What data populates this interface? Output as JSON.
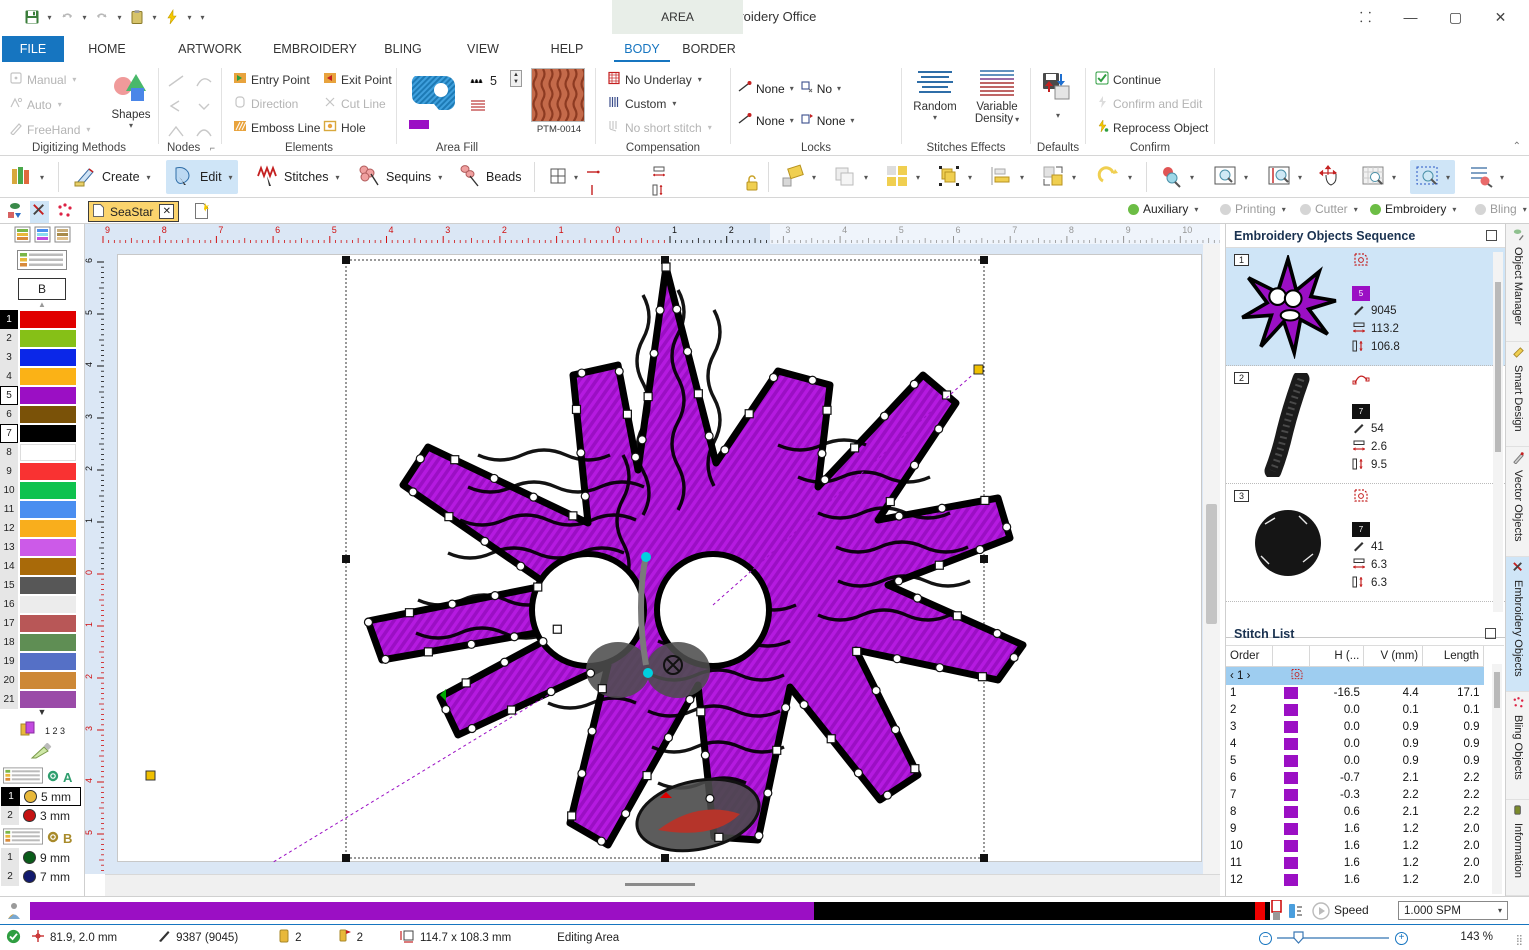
{
  "window": {
    "title": "Embroidery Office",
    "context_tab_chip": "AREA",
    "buttons": {
      "restore_small": "⸬",
      "minimize": "—",
      "maximize": "▢",
      "close": "✕"
    }
  },
  "quick_access": {
    "save": "save-icon",
    "undo": "undo-icon",
    "redo": "redo-icon",
    "paste": "clipboard-icon",
    "lightning": "lightning-icon"
  },
  "ribbon": {
    "tabs": [
      {
        "label": "FILE",
        "active": false,
        "file": true
      },
      {
        "label": "HOME",
        "active": false
      },
      {
        "label": "ARTWORK",
        "active": false
      },
      {
        "label": "EMBROIDERY",
        "active": false
      },
      {
        "label": "BLING",
        "active": false
      },
      {
        "label": "VIEW",
        "active": false
      },
      {
        "label": "HELP",
        "active": false
      },
      {
        "label": "BODY",
        "active": true
      },
      {
        "label": "BORDER",
        "active": false
      }
    ],
    "groups": {
      "digitizing": {
        "label": "Digitizing Methods",
        "items": [
          {
            "label": "Manual",
            "enabled": false
          },
          {
            "label": "Auto",
            "enabled": false
          },
          {
            "label": "FreeHand",
            "enabled": false
          }
        ],
        "shapes_label": "Shapes"
      },
      "nodes": {
        "label": "Nodes"
      },
      "elements": {
        "label": "Elements",
        "items": [
          {
            "label": "Entry Point",
            "enabled": true
          },
          {
            "label": "Exit Point",
            "enabled": true
          },
          {
            "label": "Direction",
            "enabled": false
          },
          {
            "label": "Cut Line",
            "enabled": false
          },
          {
            "label": "Emboss Line",
            "enabled": true
          },
          {
            "label": "Hole",
            "enabled": true
          }
        ]
      },
      "area_fill": {
        "label": "Area Fill",
        "stitch_count": "5",
        "pattern_code": "PTM-0014"
      },
      "compensation": {
        "label": "Compensation",
        "items": [
          {
            "label": "No Underlay",
            "enabled": true
          },
          {
            "label": "Custom",
            "enabled": true
          },
          {
            "label": "No short stitch",
            "enabled": false
          }
        ]
      },
      "locks": {
        "label": "Locks",
        "start_lock": "None",
        "start_trim": "No",
        "end_lock": "None",
        "end_trim": "None"
      },
      "stitches_effects": {
        "label": "Stitches Effects",
        "random": "Random",
        "variable_density_line1": "Variable",
        "variable_density_line2": "Density"
      },
      "defaults": {
        "label": "Defaults"
      },
      "confirm": {
        "label": "Confirm",
        "items": [
          {
            "label": "Continue",
            "enabled": true
          },
          {
            "label": "Confirm and Edit",
            "enabled": false
          },
          {
            "label": "Reprocess Object",
            "enabled": true
          }
        ]
      }
    }
  },
  "toolbar2": {
    "items": [
      {
        "label": "Create",
        "selected": false,
        "name": "create"
      },
      {
        "label": "Edit",
        "selected": true,
        "name": "edit"
      },
      {
        "label": "Stitches",
        "selected": false,
        "name": "stitches"
      },
      {
        "label": "Sequins",
        "selected": false,
        "name": "sequins"
      },
      {
        "label": "Beads",
        "selected": false,
        "name": "beads"
      }
    ],
    "pos_x": "-55.0 mm",
    "pos_y": "59.0 mm",
    "size_w": "113.2 mm",
    "size_h": "106.8 mm"
  },
  "document": {
    "tab_label": "SeaStar",
    "close_glyph": "✕"
  },
  "device_status": [
    {
      "label": "Auxiliary",
      "color": "#6cbd45"
    },
    {
      "label": "Printing",
      "color": "#cfcfcf"
    },
    {
      "label": "Cutter",
      "color": "#cfcfcf"
    },
    {
      "label": "Embroidery",
      "color": "#6cbd45"
    },
    {
      "label": "Bling",
      "color": "#cfcfcf"
    }
  ],
  "rulers": {
    "unit": "cm",
    "h_labels": [
      "9",
      "8",
      "7",
      "6",
      "5",
      "4",
      "3",
      "2",
      "1",
      "0",
      "1",
      "2",
      "3",
      "4",
      "5",
      "6",
      "7",
      "8",
      "9",
      "10"
    ],
    "v_labels": [
      "6",
      "5",
      "4",
      "3",
      "2",
      "1",
      "0",
      "1",
      "2",
      "3",
      "4",
      "5"
    ]
  },
  "palette": {
    "b_button": "B",
    "swatches": [
      {
        "n": "1",
        "color": "#e00000",
        "state": "sel"
      },
      {
        "n": "2",
        "color": "#86c017",
        "state": ""
      },
      {
        "n": "3",
        "color": "#0b27e8",
        "state": ""
      },
      {
        "n": "4",
        "color": "#fbb216",
        "state": ""
      },
      {
        "n": "5",
        "color": "#9b0fc4",
        "state": "boxed"
      },
      {
        "n": "6",
        "color": "#7a5208",
        "state": ""
      },
      {
        "n": "7",
        "color": "#000000",
        "state": "boxed"
      },
      {
        "n": "8",
        "color": "#ffffff",
        "state": ""
      },
      {
        "n": "9",
        "color": "#f93232",
        "state": ""
      },
      {
        "n": "10",
        "color": "#0ec24e",
        "state": ""
      },
      {
        "n": "11",
        "color": "#4a8ef0",
        "state": ""
      },
      {
        "n": "12",
        "color": "#f9ae1c",
        "state": ""
      },
      {
        "n": "13",
        "color": "#cc5ae8",
        "state": ""
      },
      {
        "n": "14",
        "color": "#a96a09",
        "state": ""
      },
      {
        "n": "15",
        "color": "#575757",
        "state": ""
      },
      {
        "n": "16",
        "color": "#ececec",
        "state": ""
      },
      {
        "n": "17",
        "color": "#b85757",
        "state": ""
      },
      {
        "n": "18",
        "color": "#5f8e54",
        "state": ""
      },
      {
        "n": "19",
        "color": "#5570c6",
        "state": ""
      },
      {
        "n": "20",
        "color": "#cd8836",
        "state": ""
      },
      {
        "n": "21",
        "color": "#9a4ba8",
        "state": ""
      }
    ],
    "order_badge": "1 2 3",
    "group_a": {
      "label": "A",
      "needles": [
        {
          "n": "1",
          "size": "5 mm",
          "color": "#e8b83a",
          "selected": true
        },
        {
          "n": "2",
          "size": "3 mm",
          "color": "#c41212",
          "selected": false
        }
      ]
    },
    "group_b": {
      "label": "B",
      "needles": [
        {
          "n": "1",
          "size": "9 mm",
          "color": "#0a5c1a",
          "selected": false
        },
        {
          "n": "2",
          "size": "7 mm",
          "color": "#121a6e",
          "selected": false
        }
      ]
    }
  },
  "objects_panel": {
    "title": "Embroidery Objects Sequence",
    "rows": [
      {
        "index": "1",
        "selected": true,
        "type_icon": "area-object-icon",
        "color": "#9b0fc4",
        "color_num": "5",
        "stitches": "9045",
        "width": "113.2",
        "height": "106.8",
        "thumb": "starfish"
      },
      {
        "index": "2",
        "selected": false,
        "type_icon": "line-object-icon",
        "color": "#111111",
        "color_num": "7",
        "stitches": "54",
        "width": "2.6",
        "height": "9.5",
        "thumb": "curve"
      },
      {
        "index": "3",
        "selected": false,
        "type_icon": "area-object-icon",
        "color": "#111111",
        "color_num": "7",
        "stitches": "41",
        "width": "6.3",
        "height": "6.3",
        "thumb": "blob"
      }
    ]
  },
  "stitch_list": {
    "title": "Stitch List",
    "columns": [
      "Order",
      "",
      "H (...",
      "V (mm)",
      "Length"
    ],
    "group_row": {
      "label": "‹ 1 ›"
    },
    "rows": [
      {
        "order": "1",
        "color": "#9b0fc4",
        "h": "-16.5",
        "v": "4.4",
        "len": "17.1"
      },
      {
        "order": "2",
        "color": "#9b0fc4",
        "h": "0.0",
        "v": "0.1",
        "len": "0.1"
      },
      {
        "order": "3",
        "color": "#9b0fc4",
        "h": "0.0",
        "v": "0.9",
        "len": "0.9"
      },
      {
        "order": "4",
        "color": "#9b0fc4",
        "h": "0.0",
        "v": "0.9",
        "len": "0.9"
      },
      {
        "order": "5",
        "color": "#9b0fc4",
        "h": "0.0",
        "v": "0.9",
        "len": "0.9"
      },
      {
        "order": "6",
        "color": "#9b0fc4",
        "h": "-0.7",
        "v": "2.1",
        "len": "2.2"
      },
      {
        "order": "7",
        "color": "#9b0fc4",
        "h": "-0.3",
        "v": "2.2",
        "len": "2.2"
      },
      {
        "order": "8",
        "color": "#9b0fc4",
        "h": "0.6",
        "v": "2.1",
        "len": "2.2"
      },
      {
        "order": "9",
        "color": "#9b0fc4",
        "h": "1.6",
        "v": "1.2",
        "len": "2.0"
      },
      {
        "order": "10",
        "color": "#9b0fc4",
        "h": "1.6",
        "v": "1.2",
        "len": "2.0"
      },
      {
        "order": "11",
        "color": "#9b0fc4",
        "h": "1.6",
        "v": "1.2",
        "len": "2.0"
      },
      {
        "order": "12",
        "color": "#9b0fc4",
        "h": "1.6",
        "v": "1.2",
        "len": "2.0"
      }
    ]
  },
  "side_tabs": [
    {
      "label": "Object Manager",
      "selected": false
    },
    {
      "label": "Smart Design",
      "selected": false
    },
    {
      "label": "Vector Objects",
      "selected": false
    },
    {
      "label": "Embroidery Objects",
      "selected": true
    },
    {
      "label": "Bling Objects",
      "selected": false
    },
    {
      "label": "Information",
      "selected": false
    }
  ],
  "playback": {
    "speed_label": "Speed",
    "speed_value": "1.000 SPM"
  },
  "status_bar": {
    "coords": "81.9, 2.0 mm",
    "stitch_count": "9387 (9045)",
    "colors_count": "2",
    "stops_count": "2",
    "dimensions": "114.7 x 108.3 mm",
    "mode": "Editing Area",
    "zoom": "143 %"
  },
  "colors": {
    "accent_blue": "#1675c0",
    "selection_blue": "#cfe5f7",
    "purple": "#9b0fc4",
    "tab_yellow": "#fbd46d",
    "green_dot": "#6cbd45"
  }
}
